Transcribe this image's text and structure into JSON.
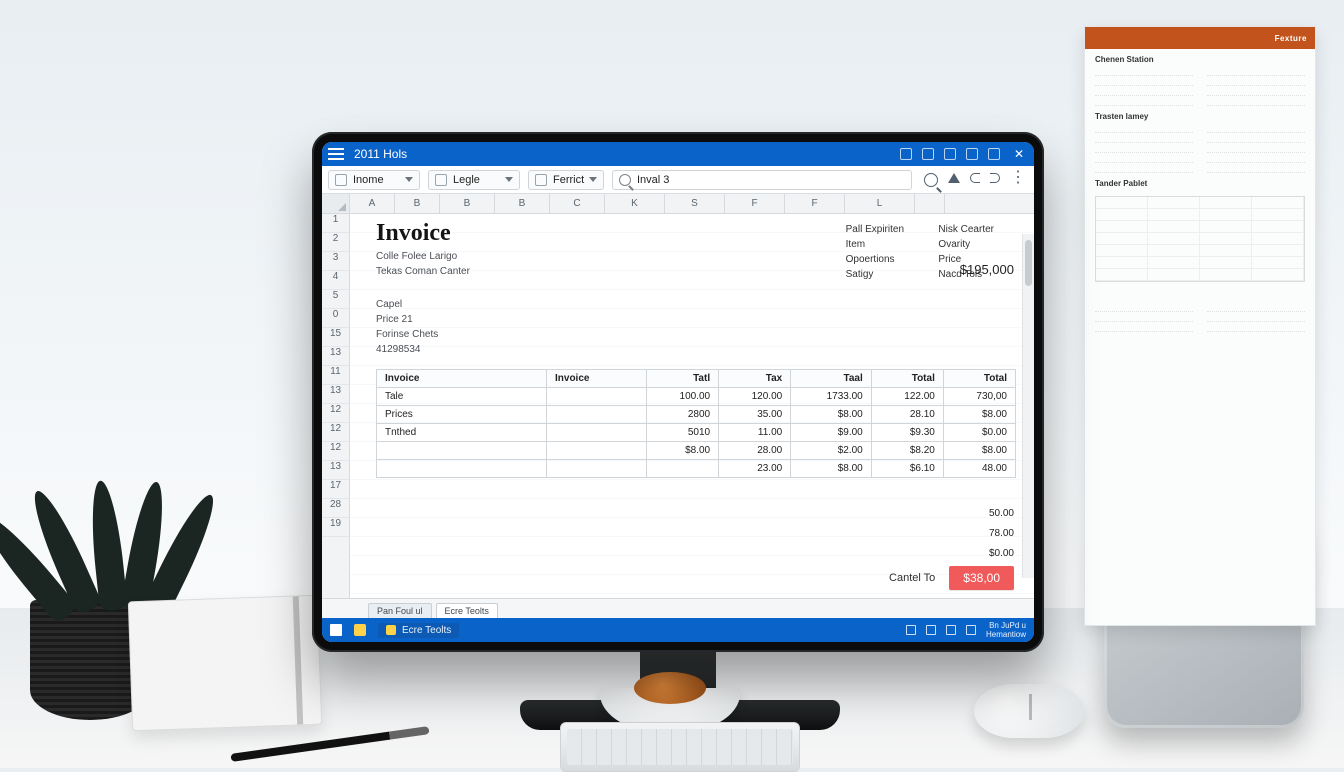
{
  "titlebar": {
    "title": "2011 Hols"
  },
  "ribbon": {
    "dd1": "Inome",
    "dd2": "Legle",
    "dd3": "Ferrict",
    "formula_text": "Inval 3"
  },
  "col_headers": [
    "A",
    "B",
    "B",
    "B",
    "C",
    "K",
    "S",
    "F",
    "F",
    "L",
    ""
  ],
  "row_numbers": [
    "1",
    "2",
    "3",
    "4",
    "5",
    "0",
    "15",
    "13",
    "11",
    "13",
    "12",
    "12",
    "12",
    "13",
    "17",
    "28",
    "19"
  ],
  "doc": {
    "title": "Invoice",
    "meta_lines": [
      "Colle Folee Larigo",
      "Tekas Coman Canter"
    ],
    "right_block_a": [
      "Pall Expiriten",
      "Item",
      "Opoertions",
      "Satigy"
    ],
    "right_block_b": [
      "Nisk Cearter",
      "Ovarity",
      "Price",
      "Nacd Tols"
    ],
    "big_amount": "$195,000",
    "section2": [
      "Capel",
      "Price  21",
      "Forinse Chets",
      "41298534"
    ]
  },
  "table": {
    "headers": [
      "Invoice",
      "Invoice",
      "Tatl",
      "Tax",
      "Taal",
      "Total",
      "Total"
    ],
    "rows": [
      [
        "Tale",
        "",
        "100.00",
        "120.00",
        "1733.00",
        "122.00",
        "730,00"
      ],
      [
        "Prices",
        "",
        "2800",
        "35.00",
        "$8.00",
        "28.10",
        "$8.00"
      ],
      [
        "Tnthed",
        "",
        "5010",
        "11.00",
        "$9.00",
        "$9.30",
        "$0.00"
      ],
      [
        "",
        "",
        "$8.00",
        "28.00",
        "$2.00",
        "$8.20",
        "$8.00"
      ],
      [
        "",
        "",
        "",
        "23.00",
        "$8.00",
        "$6.10",
        "48.00"
      ]
    ],
    "after_column": [
      "50.00",
      "78.00",
      "$0.00"
    ]
  },
  "grand": {
    "label": "Cantel To",
    "amount": "$38,00"
  },
  "sheettabs": [
    "Pan Foul ul",
    "Ecre Teolts"
  ],
  "taskbar": {
    "app": "Ecre Teolts",
    "time_l1": "Bn JuPd u",
    "time_l2": "Hemantiow"
  },
  "pinned": {
    "brand": "Fexture",
    "sections": [
      "Chenen Station",
      "Trasten lamey",
      "Tander Pablet"
    ]
  }
}
